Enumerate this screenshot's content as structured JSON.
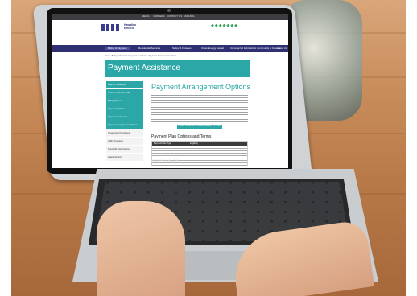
{
  "website": {
    "brand_line1": "Hawaiian",
    "brand_line2": "Electric",
    "top_links": [
      "MEDIA",
      "CAREERS",
      "CONTACT US",
      "ESPAÑOL"
    ],
    "nav_items": [
      "Billing & Payment",
      "Residential Services",
      "Safety & Outages",
      "Clean Energy Hawaii",
      "Commercial & Industrial",
      "Community & Careers",
      "About Us"
    ],
    "breadcrumb": "Home / Billing & Payment / Payment Assistance / Payment Arrangement Options",
    "hero_title": "Payment Assistance",
    "sidebar_items": [
      "Help for Customers",
      "Understanding Your Bill",
      "Billing Options",
      "Payment Options",
      "Payment Assistance",
      "Payment Arrangement Options",
      "Government Programs",
      "Utility Programs",
      "Nonprofit Organizations",
      "Hawaiʻi Energy"
    ],
    "main_title": "Payment Arrangement Options",
    "cta_label": "LEARN MORE ABOUT ARRANGEMENT OPTIONS",
    "table_title": "Payment Plan Options and Terms",
    "table_headers": [
      "Payment Plan Type",
      "Eligibility",
      "Payment Terms"
    ]
  },
  "device": {
    "label": "MacBook Air"
  },
  "colors": {
    "accent_teal": "#2aa7a6",
    "nav_purple": "#2f2f74",
    "eco_green": "#3aa35a"
  }
}
